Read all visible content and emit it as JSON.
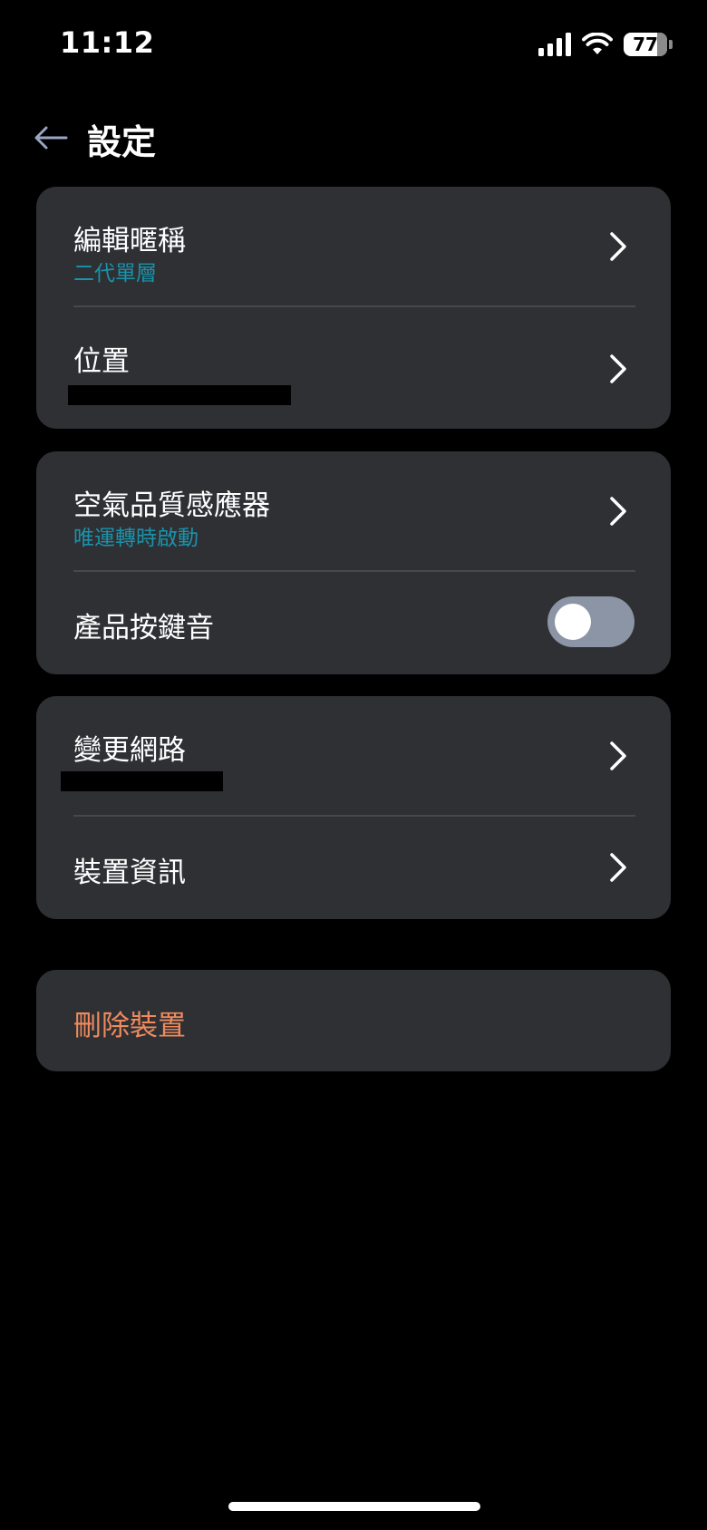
{
  "status_bar": {
    "time": "11:12",
    "battery": "77",
    "battery_level_percent": 77,
    "icons": [
      "cellular-signal-icon",
      "wifi-icon",
      "battery-icon"
    ]
  },
  "header": {
    "title": "設定",
    "back_icon": "back-arrow-icon"
  },
  "sections": {
    "general": {
      "nickname": {
        "label": "編輯暱稱",
        "value": "二代單層"
      },
      "location": {
        "label": "位置",
        "value": ""
      }
    },
    "features": {
      "air_quality_sensor": {
        "label": "空氣品質感應器",
        "value": "唯運轉時啟動"
      },
      "key_tone": {
        "label": "產品按鍵音",
        "enabled": false
      }
    },
    "network": {
      "change_network": {
        "label": "變更網路",
        "value": ""
      },
      "device_info": {
        "label": "裝置資訊"
      }
    },
    "danger": {
      "delete_device": {
        "label": "刪除裝置"
      }
    }
  },
  "colors": {
    "background": "#000000",
    "card": "#2e3034",
    "accent_text": "#1a93ab",
    "danger_text": "#f08a5d",
    "toggle_off": "#8b95a5"
  }
}
